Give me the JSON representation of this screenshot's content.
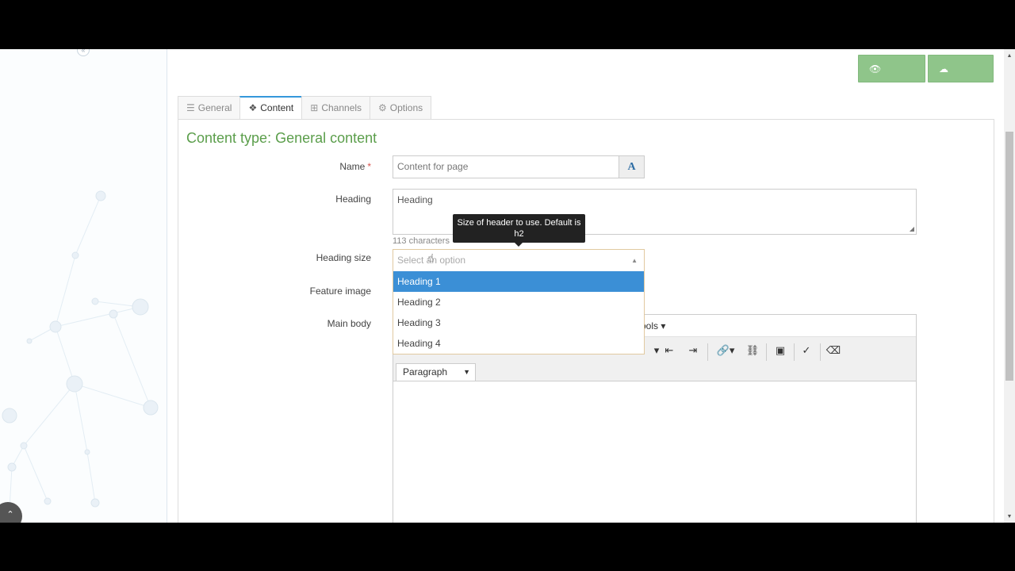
{
  "toolbar": {
    "preview_label": "Preview",
    "publish_label": "Publish"
  },
  "tabs": [
    {
      "label": "General",
      "icon": "sliders-icon"
    },
    {
      "label": "Content",
      "icon": "cubes-icon"
    },
    {
      "label": "Channels",
      "icon": "sitemap-icon"
    },
    {
      "label": "Options",
      "icon": "cogs-icon"
    }
  ],
  "form": {
    "title": "Content type: General content",
    "name": {
      "label": "Name",
      "required_mark": "*",
      "value": "Content for page",
      "addon": "A"
    },
    "heading": {
      "label": "Heading",
      "value": "Heading",
      "char_count": "113 characters"
    },
    "heading_size": {
      "label": "Heading size",
      "placeholder": "Select an option",
      "tooltip": "Size of header to use. Default is h2",
      "options": [
        "Heading 1",
        "Heading 2",
        "Heading 3",
        "Heading 4"
      ],
      "highlighted": "Heading 1"
    },
    "feature_image": {
      "label": "Feature image"
    },
    "main_body": {
      "label": "Main body",
      "menu_tools": "ools",
      "format_select": "Paragraph"
    }
  },
  "colors": {
    "accent_green": "#8fc58a",
    "title_green": "#5b9e4b",
    "selection_blue": "#3b8fd6",
    "tab_active_border": "#3498db"
  }
}
